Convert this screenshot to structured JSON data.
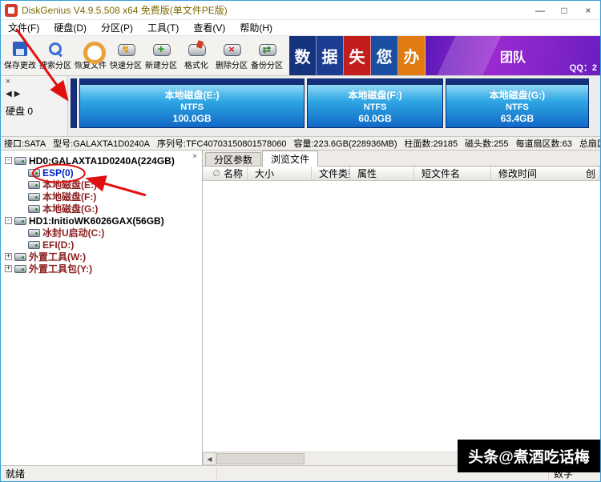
{
  "window": {
    "title": "DiskGenius V4.9.5.508 x64 免费版(单文件PE版)",
    "controls": {
      "minimize": "—",
      "maximize": "□",
      "close": "×"
    }
  },
  "menu": {
    "items": [
      "文件(F)",
      "硬盘(D)",
      "分区(P)",
      "工具(T)",
      "查看(V)",
      "帮助(H)"
    ]
  },
  "toolbar": {
    "buttons": [
      {
        "label": "保存更改",
        "icon": "floppy-icon",
        "glyph": ""
      },
      {
        "label": "搜索分区",
        "icon": "search-icon",
        "glyph": ""
      },
      {
        "label": "恢复文件",
        "icon": "recover-icon",
        "glyph": ""
      },
      {
        "label": "快速分区",
        "icon": "quick-partition-icon",
        "glyph": "↯"
      },
      {
        "label": "新建分区",
        "icon": "new-partition-icon",
        "glyph": "+"
      },
      {
        "label": "格式化",
        "icon": "format-icon",
        "glyph": ""
      },
      {
        "label": "删除分区",
        "icon": "delete-partition-icon",
        "glyph": "×"
      },
      {
        "label": "备份分区",
        "icon": "backup-icon",
        "glyph": "⇄"
      }
    ],
    "banner": {
      "tiles": [
        {
          "char": "数",
          "bg": "#16337d"
        },
        {
          "char": "据",
          "bg": "#1b3d92"
        },
        {
          "char": "失",
          "bg": "#c21e1e"
        },
        {
          "char": "您",
          "bg": "#1c4fa3"
        },
        {
          "char": "办",
          "bg": "#e07b12"
        }
      ],
      "promo": "团队",
      "qq": "QQ：2"
    }
  },
  "disk_panel": {
    "close": "×",
    "nav_prev": "◀",
    "nav_next": "▶",
    "label": "硬盘 0",
    "partitions": [
      {
        "name": "",
        "fs": "",
        "size": "",
        "w": 8,
        "variant": "esp"
      },
      {
        "name": "本地磁盘(E:)",
        "fs": "NTFS",
        "size": "100.0GB",
        "gb": 100
      },
      {
        "name": "本地磁盘(F:)",
        "fs": "NTFS",
        "size": "60.0GB",
        "gb": 60
      },
      {
        "name": "本地磁盘(G:)",
        "fs": "NTFS",
        "size": "63.4GB",
        "gb": 63.4
      }
    ]
  },
  "disk_info": {
    "segments": [
      "接口:SATA",
      "型号:GALAXTA1D0240A",
      "序列号:TFC40703150801578060",
      "容量:223.6GB(228936MB)",
      "柱面数:29185",
      "磁头数:255",
      "每道扇区数:63",
      "总扇区数:"
    ]
  },
  "tree": {
    "close": "×",
    "items": [
      {
        "level": 0,
        "expander": "-",
        "icon": "hard-disk-icon",
        "label": "HD0:GALAXTA1D0240A(224GB)",
        "color": "#000000",
        "bold": true
      },
      {
        "level": 1,
        "expander": "",
        "icon": "partition-icon",
        "label": "ESP(0)",
        "color": "#0026c8",
        "bold": true,
        "selected": true
      },
      {
        "level": 1,
        "expander": "",
        "icon": "partition-icon",
        "label": "本地磁盘(E:)",
        "color": "#8b1f1f",
        "bold": true
      },
      {
        "level": 1,
        "expander": "",
        "icon": "partition-icon",
        "label": "本地磁盘(F:)",
        "color": "#8b1f1f",
        "bold": true
      },
      {
        "level": 1,
        "expander": "",
        "icon": "partition-icon",
        "label": "本地磁盘(G:)",
        "color": "#8b1f1f",
        "bold": true
      },
      {
        "level": 0,
        "expander": "-",
        "icon": "hard-disk-icon",
        "label": "HD1:InitioWK6026GAX(56GB)",
        "color": "#000000",
        "bold": true
      },
      {
        "level": 1,
        "expander": "",
        "icon": "partition-icon",
        "label": "冰封U启动(C:)",
        "color": "#8b1f1f",
        "bold": true
      },
      {
        "level": 1,
        "expander": "",
        "icon": "partition-icon",
        "label": "EFI(D:)",
        "color": "#8b1f1f",
        "bold": true
      },
      {
        "level": 0,
        "expander": "+",
        "icon": "hard-disk-icon",
        "label": "外置工具(W:)",
        "color": "#8b1f1f",
        "bold": true
      },
      {
        "level": 0,
        "expander": "+",
        "icon": "hard-disk-icon",
        "label": "外置工具包(Y:)",
        "color": "#8b1f1f",
        "bold": true
      }
    ]
  },
  "tabs": {
    "items": [
      {
        "label": "分区参数",
        "state": ""
      },
      {
        "label": "浏览文件",
        "state": "active"
      }
    ]
  },
  "file_table": {
    "columns": [
      {
        "label": "名称",
        "icon": "∅"
      },
      {
        "label": "大小",
        "icon": ""
      },
      {
        "label": "文件类型",
        "icon": ""
      },
      {
        "label": "属性",
        "icon": ""
      },
      {
        "label": "短文件名",
        "icon": ""
      },
      {
        "label": "修改时间",
        "icon": ""
      },
      {
        "label": "创",
        "icon": ""
      }
    ]
  },
  "hscroll": {
    "prev": "◀",
    "next": "▶"
  },
  "statusbar": {
    "ready": "就绪",
    "num_label": "数字"
  },
  "watermark": {
    "text": "头条@煮酒吃话梅"
  }
}
